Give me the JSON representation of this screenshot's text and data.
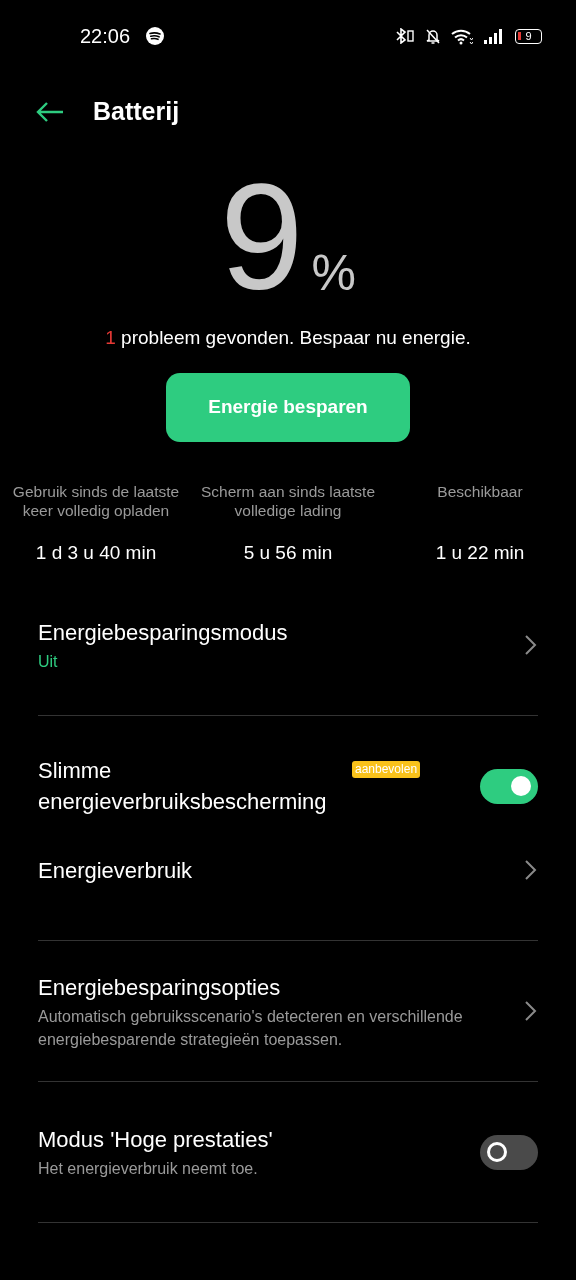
{
  "status_bar": {
    "time": "22:06",
    "battery": "9"
  },
  "header": {
    "title": "Batterij"
  },
  "level": {
    "value": "9",
    "unit": "%"
  },
  "problem": {
    "count": "1",
    "text": "probleem gevonden. Bespaar nu energie."
  },
  "save_button": "Energie besparen",
  "stats": [
    {
      "label": "Gebruik sinds de laatste keer volledig opladen",
      "value": "1 d 3 u 40 min"
    },
    {
      "label": "Scherm aan sinds laatste volledige lading",
      "value": "5 u 56 min"
    },
    {
      "label": "Beschikbaar",
      "value": "1 u 22 min"
    }
  ],
  "sections": [
    {
      "items": [
        {
          "kind": "nav",
          "title": "Energiebesparingsmodus",
          "status": "Uit"
        }
      ]
    },
    {
      "items": [
        {
          "kind": "toggle",
          "title": "Slimme energieverbruiksbescherming",
          "badge": "aanbevolen",
          "on": true
        },
        {
          "kind": "nav",
          "title": "Energieverbruik"
        }
      ]
    },
    {
      "items": [
        {
          "kind": "nav",
          "title": "Energiebesparingsopties",
          "subtitle": "Automatisch gebruiksscenario's detecteren en verschillende energiebesparende strategieën toepassen."
        }
      ]
    },
    {
      "items": [
        {
          "kind": "toggle",
          "title": "Modus 'Hoge prestaties'",
          "subtitle": "Het energieverbruik neemt toe.",
          "on": false
        }
      ]
    }
  ]
}
